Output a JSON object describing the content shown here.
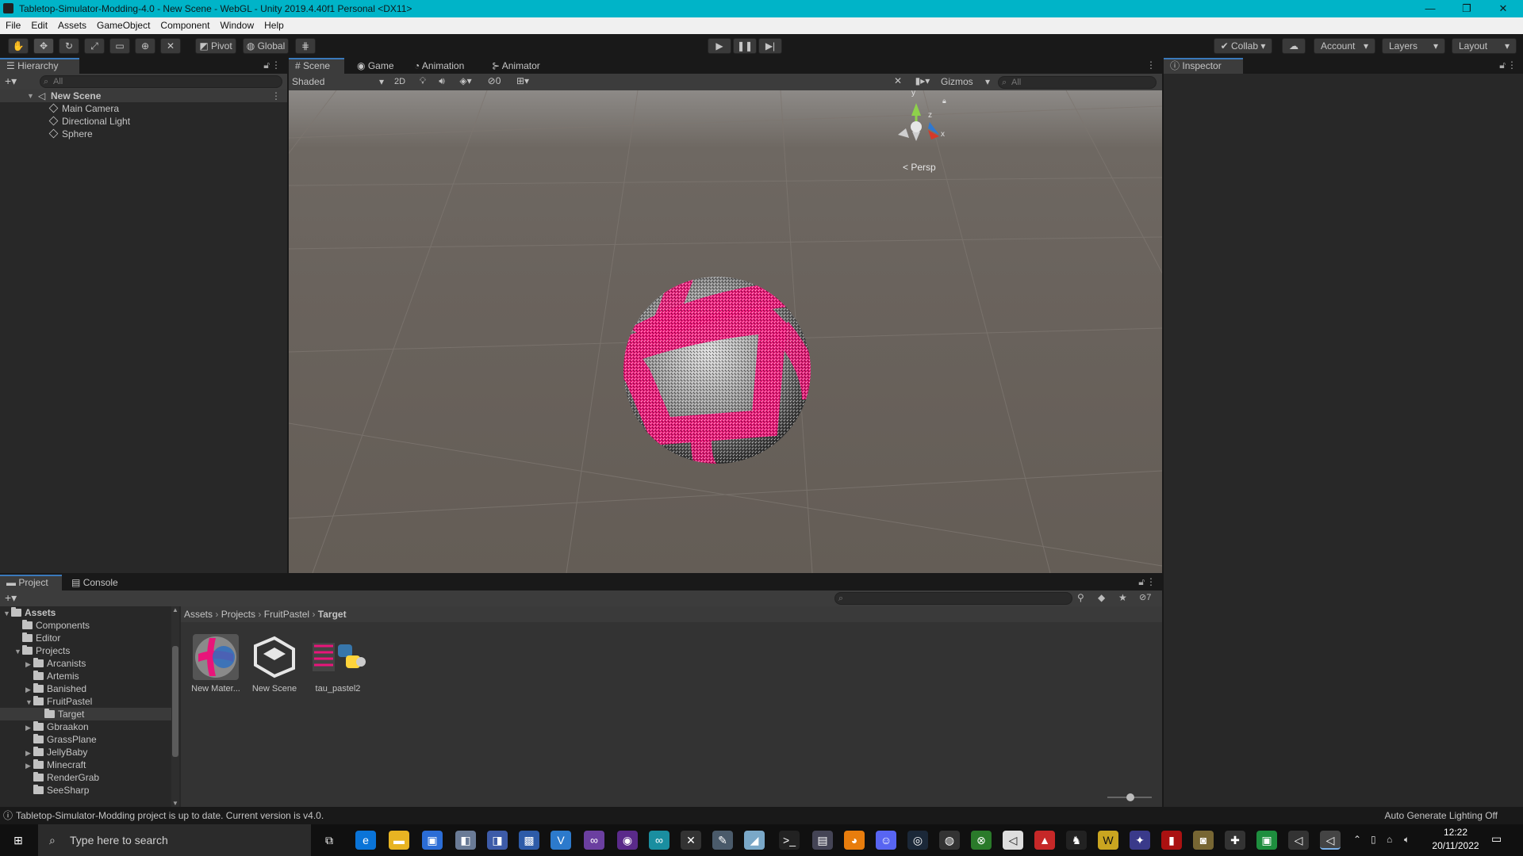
{
  "window": {
    "title": "Tabletop-Simulator-Modding-4.0 - New Scene - WebGL - Unity 2019.4.40f1 Personal <DX11>",
    "minimize": "—",
    "maximize": "❐",
    "close": "✕"
  },
  "menu": [
    "File",
    "Edit",
    "Assets",
    "GameObject",
    "Component",
    "Window",
    "Help"
  ],
  "toolbar": {
    "pivot": "Pivot",
    "global": "Global",
    "collab": "Collab",
    "account": "Account",
    "layers": "Layers",
    "layout": "Layout"
  },
  "hierarchy": {
    "tab": "Hierarchy",
    "search_placeholder": "All",
    "scene": "New Scene",
    "items": [
      "Main Camera",
      "Directional Light",
      "Sphere"
    ]
  },
  "scene_tabs": [
    "Scene",
    "Game",
    "Animation",
    "Animator"
  ],
  "scene_toolbar": {
    "shading": "Shaded",
    "mode2d": "2D",
    "hidden_count": "0",
    "gizmos": "Gizmos",
    "search_placeholder": "All"
  },
  "scene_gizmo": {
    "y": "y",
    "z": "z",
    "x": "x",
    "persp": "< Persp"
  },
  "inspector": {
    "tab": "Inspector"
  },
  "project": {
    "tabs": [
      "Project",
      "Console"
    ],
    "tree": {
      "root": "Assets",
      "items": [
        {
          "label": "Components",
          "level": 1,
          "expand": ""
        },
        {
          "label": "Editor",
          "level": 1,
          "expand": ""
        },
        {
          "label": "Projects",
          "level": 1,
          "expand": "▼"
        },
        {
          "label": "Arcanists",
          "level": 2,
          "expand": "▶"
        },
        {
          "label": "Artemis",
          "level": 2,
          "expand": ""
        },
        {
          "label": "Banished",
          "level": 2,
          "expand": "▶"
        },
        {
          "label": "FruitPastel",
          "level": 2,
          "expand": "▼"
        },
        {
          "label": "Target",
          "level": 3,
          "expand": ""
        },
        {
          "label": "Gbraakon",
          "level": 2,
          "expand": "▶"
        },
        {
          "label": "GrassPlane",
          "level": 2,
          "expand": ""
        },
        {
          "label": "JellyBaby",
          "level": 2,
          "expand": "▶"
        },
        {
          "label": "Minecraft",
          "level": 2,
          "expand": "▶"
        },
        {
          "label": "RenderGrab",
          "level": 2,
          "expand": ""
        },
        {
          "label": "SeeSharp",
          "level": 2,
          "expand": ""
        }
      ]
    },
    "breadcrumb": [
      "Assets",
      "Projects",
      "FruitPastel",
      "Target"
    ],
    "assets": [
      "New Mater...",
      "New Scene",
      "tau_pastel2"
    ],
    "hidden_count": "7"
  },
  "status": {
    "message": "Tabletop-Simulator-Modding project is up to date. Current version is v4.0.",
    "right": "Auto Generate Lighting Off"
  },
  "taskbar": {
    "search_placeholder": "Type here to search",
    "time": "12:22",
    "date": "20/11/2022"
  }
}
